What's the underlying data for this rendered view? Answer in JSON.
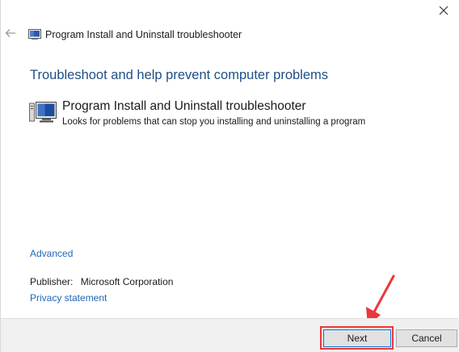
{
  "window": {
    "title": "Program Install and Uninstall troubleshooter"
  },
  "main": {
    "heading": "Troubleshoot and help prevent computer problems",
    "item": {
      "title": "Program Install and Uninstall troubleshooter",
      "description": "Looks for problems that can stop you installing and uninstalling a program",
      "icon": "troubleshooter-monitor-icon"
    }
  },
  "links": {
    "advanced": "Advanced",
    "privacy": "Privacy statement"
  },
  "publisher": {
    "label": "Publisher:",
    "value": "Microsoft Corporation"
  },
  "footer": {
    "next_label": "Next",
    "cancel_label": "Cancel"
  },
  "colors": {
    "heading": "#1e4f87",
    "link": "#1f66b5",
    "highlight": "#e8383d",
    "footer_bg": "#f0f0f0"
  },
  "icons": {
    "close": "close-icon",
    "back": "back-arrow-icon",
    "title": "troubleshooter-icon",
    "annotation": "red-arrow-annotation"
  }
}
